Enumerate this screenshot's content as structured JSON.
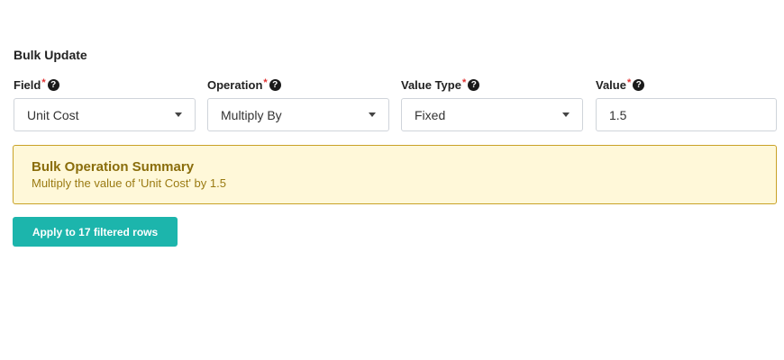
{
  "section": {
    "title": "Bulk Update"
  },
  "fields": [
    {
      "label": "Field",
      "required_mark": "*",
      "value": "Unit Cost",
      "kind": "select"
    },
    {
      "label": "Operation",
      "required_mark": "*",
      "value": "Multiply By",
      "kind": "select"
    },
    {
      "label": "Value Type",
      "required_mark": "*",
      "value": "Fixed",
      "kind": "select"
    },
    {
      "label": "Value",
      "required_mark": "*",
      "value": "1.5",
      "kind": "input"
    }
  ],
  "help_icon_glyph": "?",
  "icons": {
    "help": "question-circle-icon",
    "dropdown": "caret-down-icon"
  },
  "summary": {
    "title": "Bulk Operation Summary",
    "text": "Multiply the value of 'Unit Cost' by 1.5"
  },
  "apply_button": {
    "label": "Apply to 17 filtered rows"
  },
  "colors": {
    "accent": "#1cb5ac",
    "summary_bg": "#fff8d9",
    "summary_border": "#c9a227",
    "summary_title": "#8a6d0b",
    "required": "#e03131"
  }
}
